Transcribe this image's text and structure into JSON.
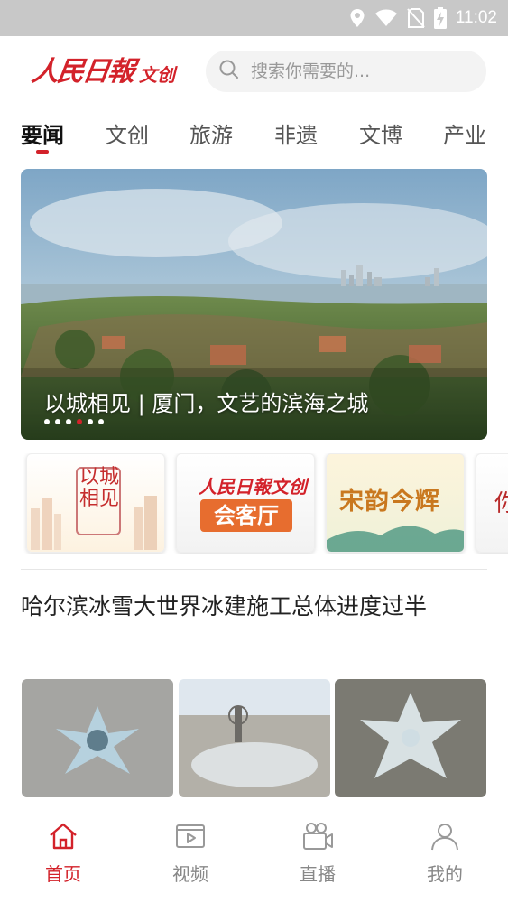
{
  "status_bar": {
    "time": "11:02"
  },
  "header": {
    "logo_main": "人民日報",
    "logo_sub": "文创",
    "search_placeholder": "搜索你需要的..."
  },
  "tabs": [
    {
      "label": "要闻",
      "active": true
    },
    {
      "label": "文创",
      "active": false
    },
    {
      "label": "旅游",
      "active": false
    },
    {
      "label": "非遗",
      "active": false
    },
    {
      "label": "文博",
      "active": false
    },
    {
      "label": "产业",
      "active": false
    }
  ],
  "banner": {
    "caption": "以城相见 | 厦门，文艺的滨海之城",
    "slide_count": 6,
    "active_slide": 4
  },
  "feature_cards": {
    "card1_title": "以城相见",
    "card2_logo": "人民日報文创",
    "card2_label": "会客厅",
    "card3_title": "宋韵今辉",
    "card4_title": "你"
  },
  "article": {
    "headline": "哈尔滨冰雪大世界冰建施工总体进度过半"
  },
  "bottom_nav": [
    {
      "label": "首页",
      "icon": "home-icon",
      "active": true
    },
    {
      "label": "视频",
      "icon": "video-icon",
      "active": false
    },
    {
      "label": "直播",
      "icon": "live-camera-icon",
      "active": false
    },
    {
      "label": "我的",
      "icon": "profile-icon",
      "active": false
    }
  ],
  "colors": {
    "accent": "#d3222a",
    "inactive": "#888888"
  }
}
